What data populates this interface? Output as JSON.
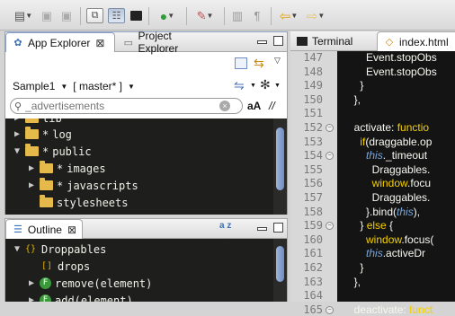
{
  "toolbar": {
    "icons": [
      "new-icon",
      "save-icon",
      "save-all-icon",
      "link-icon",
      "perspective-icon",
      "terminal-icon",
      "run-icon",
      "external-tools-icon",
      "toggle-mark-icon",
      "block-selection-icon",
      "back-arrow-icon",
      "forward-arrow-icon"
    ]
  },
  "app_explorer": {
    "tab_label": "App Explorer",
    "other_tab_label": "Project Explorer",
    "project_label": "Sample1",
    "branch_label": "[ master* ]",
    "filter_placeholder": "_advertisements",
    "match_case_label": "aA",
    "regex_label": "//",
    "tree": [
      {
        "label": "lib",
        "indent": 0,
        "expanded": false,
        "star": false,
        "partial": true
      },
      {
        "label": "log",
        "indent": 0,
        "expanded": false,
        "star": true
      },
      {
        "label": "public",
        "indent": 0,
        "expanded": true,
        "star": true
      },
      {
        "label": "images",
        "indent": 1,
        "expanded": false,
        "star": true
      },
      {
        "label": "javascripts",
        "indent": 1,
        "expanded": false,
        "star": true
      },
      {
        "label": "stylesheets",
        "indent": 1,
        "expanded": false,
        "star": false
      }
    ]
  },
  "outline": {
    "tab_label": "Outline",
    "sort_label": "a z",
    "items": [
      {
        "label": "Droppables",
        "kind": "object",
        "indent": 0,
        "expanded": true
      },
      {
        "label": "drops",
        "kind": "array",
        "indent": 1
      },
      {
        "label": "remove(element)",
        "kind": "function",
        "indent": 1
      },
      {
        "label": "add(element)",
        "kind": "function",
        "indent": 1
      }
    ]
  },
  "editor": {
    "tabs": [
      "Terminal",
      "index.html"
    ],
    "lines": [
      {
        "n": "147",
        "fold": false,
        "segments": [
          {
            "t": "      Event.stopObs",
            "c": ""
          }
        ]
      },
      {
        "n": "148",
        "fold": false,
        "segments": [
          {
            "t": "      Event.stopObs",
            "c": ""
          }
        ]
      },
      {
        "n": "149",
        "fold": false,
        "segments": [
          {
            "t": "    }",
            "c": ""
          }
        ]
      },
      {
        "n": "150",
        "fold": false,
        "segments": [
          {
            "t": "  },",
            "c": ""
          }
        ]
      },
      {
        "n": "151",
        "fold": false,
        "segments": [
          {
            "t": "",
            "c": ""
          }
        ]
      },
      {
        "n": "152",
        "fold": true,
        "segments": [
          {
            "t": "  activate",
            "c": ""
          },
          {
            "t": ": ",
            "c": ""
          },
          {
            "t": "functio",
            "c": "kw"
          }
        ]
      },
      {
        "n": "153",
        "fold": false,
        "segments": [
          {
            "t": "    ",
            "c": ""
          },
          {
            "t": "if",
            "c": "kw"
          },
          {
            "t": "(draggable.op",
            "c": ""
          }
        ]
      },
      {
        "n": "154",
        "fold": true,
        "segments": [
          {
            "t": "      ",
            "c": ""
          },
          {
            "t": "this",
            "c": "it"
          },
          {
            "t": "._timeout",
            "c": ""
          }
        ]
      },
      {
        "n": "155",
        "fold": false,
        "segments": [
          {
            "t": "        Draggables.",
            "c": ""
          }
        ]
      },
      {
        "n": "156",
        "fold": false,
        "segments": [
          {
            "t": "        ",
            "c": ""
          },
          {
            "t": "window",
            "c": "fn"
          },
          {
            "t": ".focu",
            "c": ""
          }
        ]
      },
      {
        "n": "157",
        "fold": false,
        "segments": [
          {
            "t": "        Draggables.",
            "c": ""
          }
        ]
      },
      {
        "n": "158",
        "fold": false,
        "segments": [
          {
            "t": "      }.bind(",
            "c": ""
          },
          {
            "t": "this",
            "c": "it"
          },
          {
            "t": "),",
            "c": ""
          }
        ]
      },
      {
        "n": "159",
        "fold": true,
        "segments": [
          {
            "t": "    } ",
            "c": ""
          },
          {
            "t": "else",
            "c": "kw"
          },
          {
            "t": " {",
            "c": ""
          }
        ]
      },
      {
        "n": "160",
        "fold": false,
        "segments": [
          {
            "t": "      ",
            "c": ""
          },
          {
            "t": "window",
            "c": "fn"
          },
          {
            "t": ".focus(",
            "c": ""
          }
        ]
      },
      {
        "n": "161",
        "fold": false,
        "segments": [
          {
            "t": "      ",
            "c": ""
          },
          {
            "t": "this",
            "c": "it"
          },
          {
            "t": ".activeDr",
            "c": ""
          }
        ]
      },
      {
        "n": "162",
        "fold": false,
        "segments": [
          {
            "t": "    }",
            "c": ""
          }
        ]
      },
      {
        "n": "163",
        "fold": false,
        "segments": [
          {
            "t": "  },",
            "c": ""
          }
        ]
      },
      {
        "n": "164",
        "fold": false,
        "segments": [
          {
            "t": "",
            "c": ""
          }
        ]
      },
      {
        "n": "165",
        "fold": true,
        "segments": [
          {
            "t": "  deactivate",
            "c": ""
          },
          {
            "t": ": ",
            "c": ""
          },
          {
            "t": "funct",
            "c": "kw"
          }
        ]
      }
    ]
  },
  "colors": {
    "accent_blue": "#6f8cc4",
    "editor_bg": "#141414",
    "tree_bg": "#1e1f1c",
    "keyword": "#f5d000",
    "this_keyword": "#7aa6da"
  }
}
